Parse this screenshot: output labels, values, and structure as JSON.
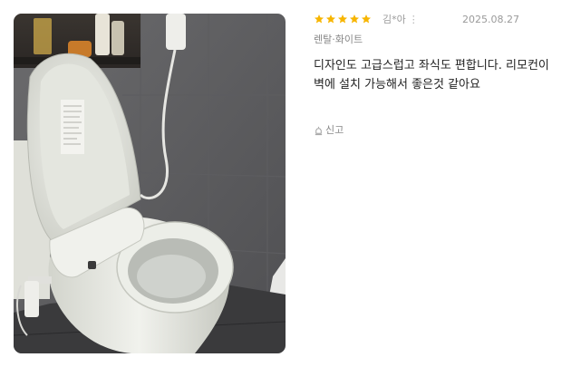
{
  "review": {
    "rating": 5,
    "author": "김*아",
    "more_icon": "⋮",
    "date": "2025.08.27",
    "option": "렌탈·화이트",
    "text": "디자인도 고급스럽고 좌식도 편합니다. 리모컨이 벽에 설치 가능해서 좋은것 같아요",
    "report_label": "신고",
    "report_icon": "siren-icon",
    "star_icon": "star-icon",
    "star_color": "#f7b500"
  }
}
